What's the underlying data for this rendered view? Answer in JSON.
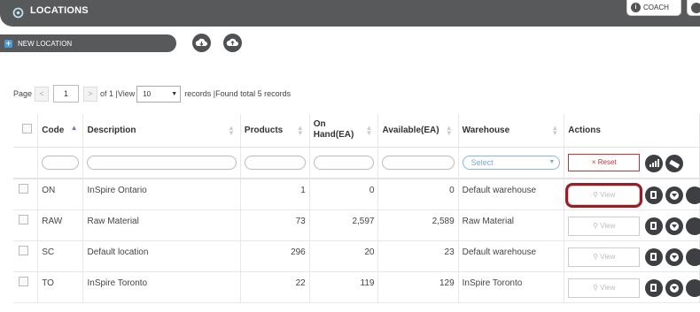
{
  "header": {
    "title": "LOCATIONS",
    "coach_label": "COACH"
  },
  "toolbar": {
    "new_location_label": "NEW LOCATION"
  },
  "pager": {
    "page_label": "Page",
    "prev_label": "<",
    "page_value": "1",
    "next_label": ">",
    "of_label": "of 1 |View",
    "view_value": "10",
    "records_label": "records |Found total 5 records"
  },
  "table": {
    "columns": {
      "code": "Code",
      "description": "Description",
      "products": "Products",
      "on_hand": "On Hand(EA)",
      "available": "Available(EA)",
      "warehouse": "Warehouse",
      "actions": "Actions"
    },
    "filters": {
      "warehouse_placeholder": "Select",
      "reset_label": "× Reset"
    },
    "view_label": "View",
    "rows": [
      {
        "code": "ON",
        "description": "InSpire Ontario",
        "products": "1",
        "on_hand": "0",
        "available": "0",
        "warehouse": "Default warehouse"
      },
      {
        "code": "RAW",
        "description": "Raw Material",
        "products": "73",
        "on_hand": "2,597",
        "available": "2,589",
        "warehouse": "Raw Material"
      },
      {
        "code": "SC",
        "description": "Default location",
        "products": "296",
        "on_hand": "20",
        "available": "23",
        "warehouse": "Default warehouse"
      },
      {
        "code": "TO",
        "description": "InSpire Toronto",
        "products": "22",
        "on_hand": "119",
        "available": "129",
        "warehouse": "InSpire Toronto"
      }
    ]
  },
  "colors": {
    "header_bg": "#58595b",
    "highlight": "#9b1c22",
    "reset": "#cc3333",
    "accent": "#4a9bd6"
  }
}
